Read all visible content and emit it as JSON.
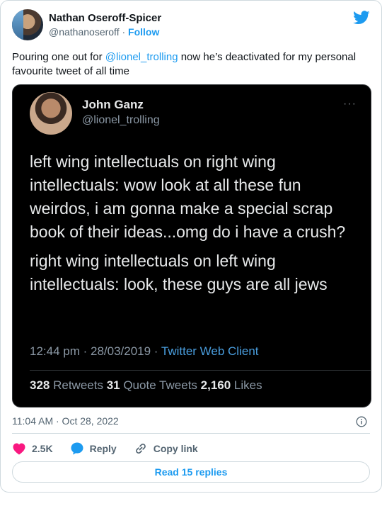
{
  "author": {
    "name": "Nathan Oseroff-Spicer",
    "handle": "@nathanoseroff",
    "separator": "·",
    "follow_label": "Follow"
  },
  "tweet": {
    "text_before": "Pouring one out for ",
    "mention": "@lionel_trolling",
    "text_after": " now he’s deactivated for my personal favourite tweet of all time"
  },
  "quoted": {
    "name": "John Ganz",
    "handle": "@lionel_trolling",
    "more": "···",
    "paragraph1": "left wing intellectuals on right wing intellectuals: wow look at all these fun weirdos, i am gonna make a special scrap book of their ideas...omg do i have a crush?",
    "paragraph2": "right wing intellectuals on left wing intellectuals: look, these guys are all jews",
    "time": "12:44 pm · 28/03/2019 · ",
    "client": "Twitter Web Client",
    "retweets_count": "328",
    "retweets_label": " Retweets ",
    "quotes_count": "31",
    "quotes_label": " Quote Tweets ",
    "likes_count": "2,160",
    "likes_label": " Likes"
  },
  "timestamp": "11:04 AM · Oct 28, 2022",
  "actions": {
    "likes": "2.5K",
    "reply": "Reply",
    "copy_link": "Copy link"
  },
  "read_replies": "Read 15 replies",
  "colors": {
    "accent": "#1d9bf0",
    "heart": "#f91880",
    "embed_bg": "#000000"
  },
  "icons": [
    "twitter-bird-icon",
    "info-icon",
    "heart-icon",
    "reply-bubble-icon",
    "link-icon"
  ]
}
